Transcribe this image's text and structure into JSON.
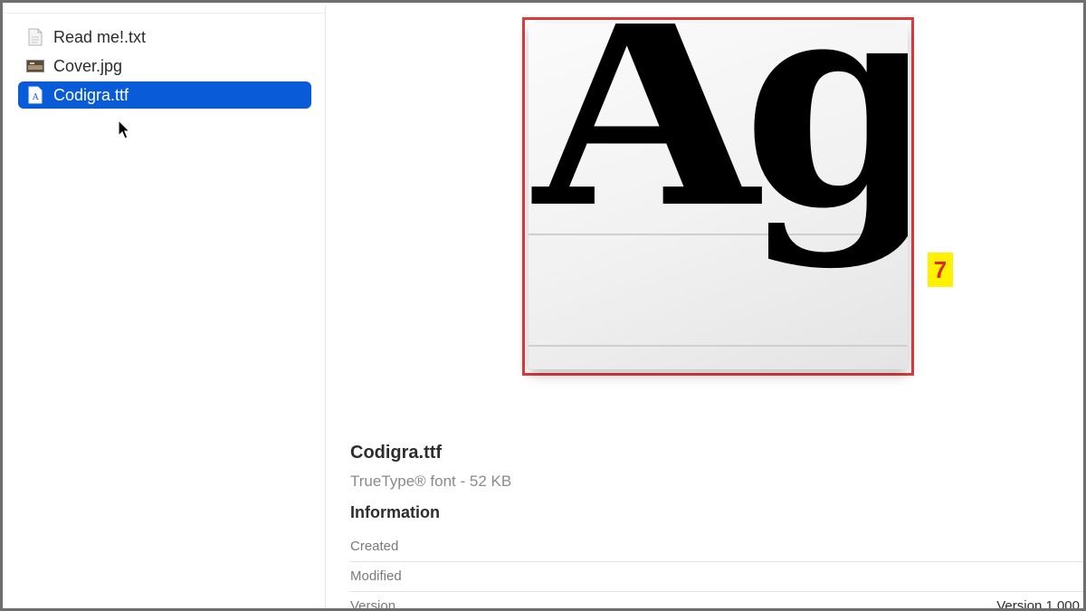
{
  "sidebar": {
    "files": [
      {
        "name": "Read me!.txt",
        "icon": "text-file-icon",
        "selected": false
      },
      {
        "name": "Cover.jpg",
        "icon": "image-file-icon",
        "selected": false
      },
      {
        "name": "Codigra.ttf",
        "icon": "font-file-icon",
        "selected": true
      }
    ]
  },
  "preview": {
    "glyphs": "Ag",
    "badge": "7"
  },
  "info": {
    "title": "Codigra.ttf",
    "subtitle": "TrueType® font - 52 KB",
    "heading": "Information",
    "rows": [
      {
        "label": "Created",
        "value": ""
      },
      {
        "label": "Modified",
        "value": ""
      },
      {
        "label": "Version",
        "value": "Version 1.000"
      }
    ]
  },
  "colors": {
    "selection": "#0a5bd8",
    "highlight_border": "#e03a3e",
    "badge_bg": "#fff200",
    "badge_text": "#e0281e"
  }
}
